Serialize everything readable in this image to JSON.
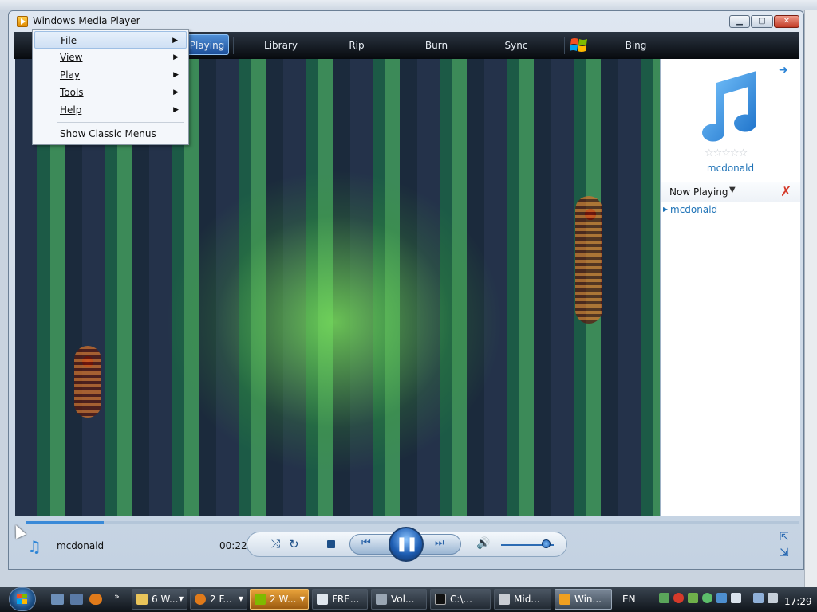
{
  "window": {
    "title": "Windows Media Player"
  },
  "tabs": [
    {
      "label": "Playing"
    },
    {
      "label": "Library"
    },
    {
      "label": "Rip"
    },
    {
      "label": "Burn"
    },
    {
      "label": "Sync"
    },
    {
      "label": "Bing"
    }
  ],
  "menu": {
    "items": [
      {
        "label": "File",
        "submenu": true
      },
      {
        "label": "View",
        "submenu": true
      },
      {
        "label": "Play",
        "submenu": true
      },
      {
        "label": "Tools",
        "submenu": true
      },
      {
        "label": "Help",
        "submenu": true
      }
    ],
    "classic_menus": "Show Classic Menus"
  },
  "pane": {
    "album_title": "mcdonald",
    "rating_stars": 0,
    "now_playing_label": "Now Playing",
    "playlist": [
      "mcdonald"
    ]
  },
  "controls": {
    "track_title": "mcdonald",
    "time": "00:22",
    "seek_progress": 0.1,
    "volume_level": 0.85
  },
  "taskbar": {
    "buttons": [
      {
        "label": "6 W...",
        "icon": "folder-icon"
      },
      {
        "label": "2 F...",
        "icon": "firefox-icon"
      },
      {
        "label": "2 W...",
        "icon": "windows-icon"
      },
      {
        "label": "FRE...",
        "icon": "document-icon"
      },
      {
        "label": "Vol...",
        "icon": "volume-icon"
      },
      {
        "label": "C:\\...",
        "icon": "command-prompt-icon"
      },
      {
        "label": "Mid...",
        "icon": "midi-icon"
      },
      {
        "label": "Win...",
        "icon": "media-player-icon"
      }
    ],
    "language": "EN",
    "clock": "17:29"
  },
  "colors": {
    "accent": "#2c84d6",
    "tab_bar": "#0b0f14",
    "selected_tab": "#2f6cb8",
    "link": "#1f73b7",
    "clear_icon": "#d43a2a"
  }
}
